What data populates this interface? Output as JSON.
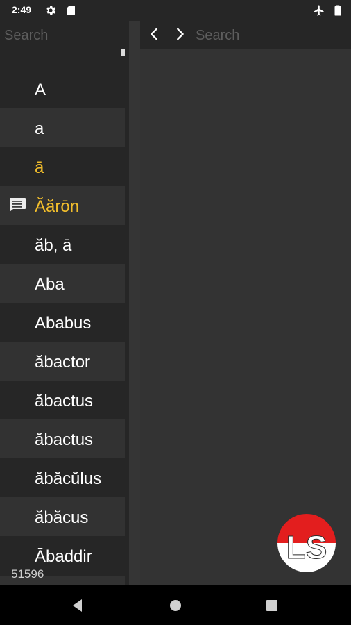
{
  "status_bar": {
    "time": "2:49"
  },
  "left_pane": {
    "search_placeholder": "Search",
    "words": [
      {
        "label": "A",
        "highlight": false,
        "note": false
      },
      {
        "label": "a",
        "highlight": false,
        "note": false
      },
      {
        "label": "ā",
        "highlight": true,
        "note": false
      },
      {
        "label": "Ăărōn",
        "highlight": true,
        "note": true
      },
      {
        "label": "ăb, ā",
        "highlight": false,
        "note": false
      },
      {
        "label": "Aba",
        "highlight": false,
        "note": false
      },
      {
        "label": "Ababus",
        "highlight": false,
        "note": false
      },
      {
        "label": "ăbactor",
        "highlight": false,
        "note": false
      },
      {
        "label": "ăbactus",
        "highlight": false,
        "note": false
      },
      {
        "label": "ăbactus",
        "highlight": false,
        "note": false
      },
      {
        "label": "ăbăcŭlus",
        "highlight": false,
        "note": false
      },
      {
        "label": "ăbăcus",
        "highlight": false,
        "note": false
      },
      {
        "label": "Ābaddir",
        "highlight": false,
        "note": false
      }
    ],
    "entry_count": "51596"
  },
  "right_pane": {
    "search_placeholder": "Search"
  },
  "logo": {
    "text": "LS"
  },
  "colors": {
    "highlight": "#f2be2c",
    "logo_red": "#e31e1e"
  },
  "icons": [
    "gear-icon",
    "sd-card-icon",
    "airplane-icon",
    "battery-icon",
    "chevron-left-icon",
    "chevron-right-icon",
    "note-icon",
    "nav-back-icon",
    "nav-home-icon",
    "nav-recents-icon"
  ]
}
